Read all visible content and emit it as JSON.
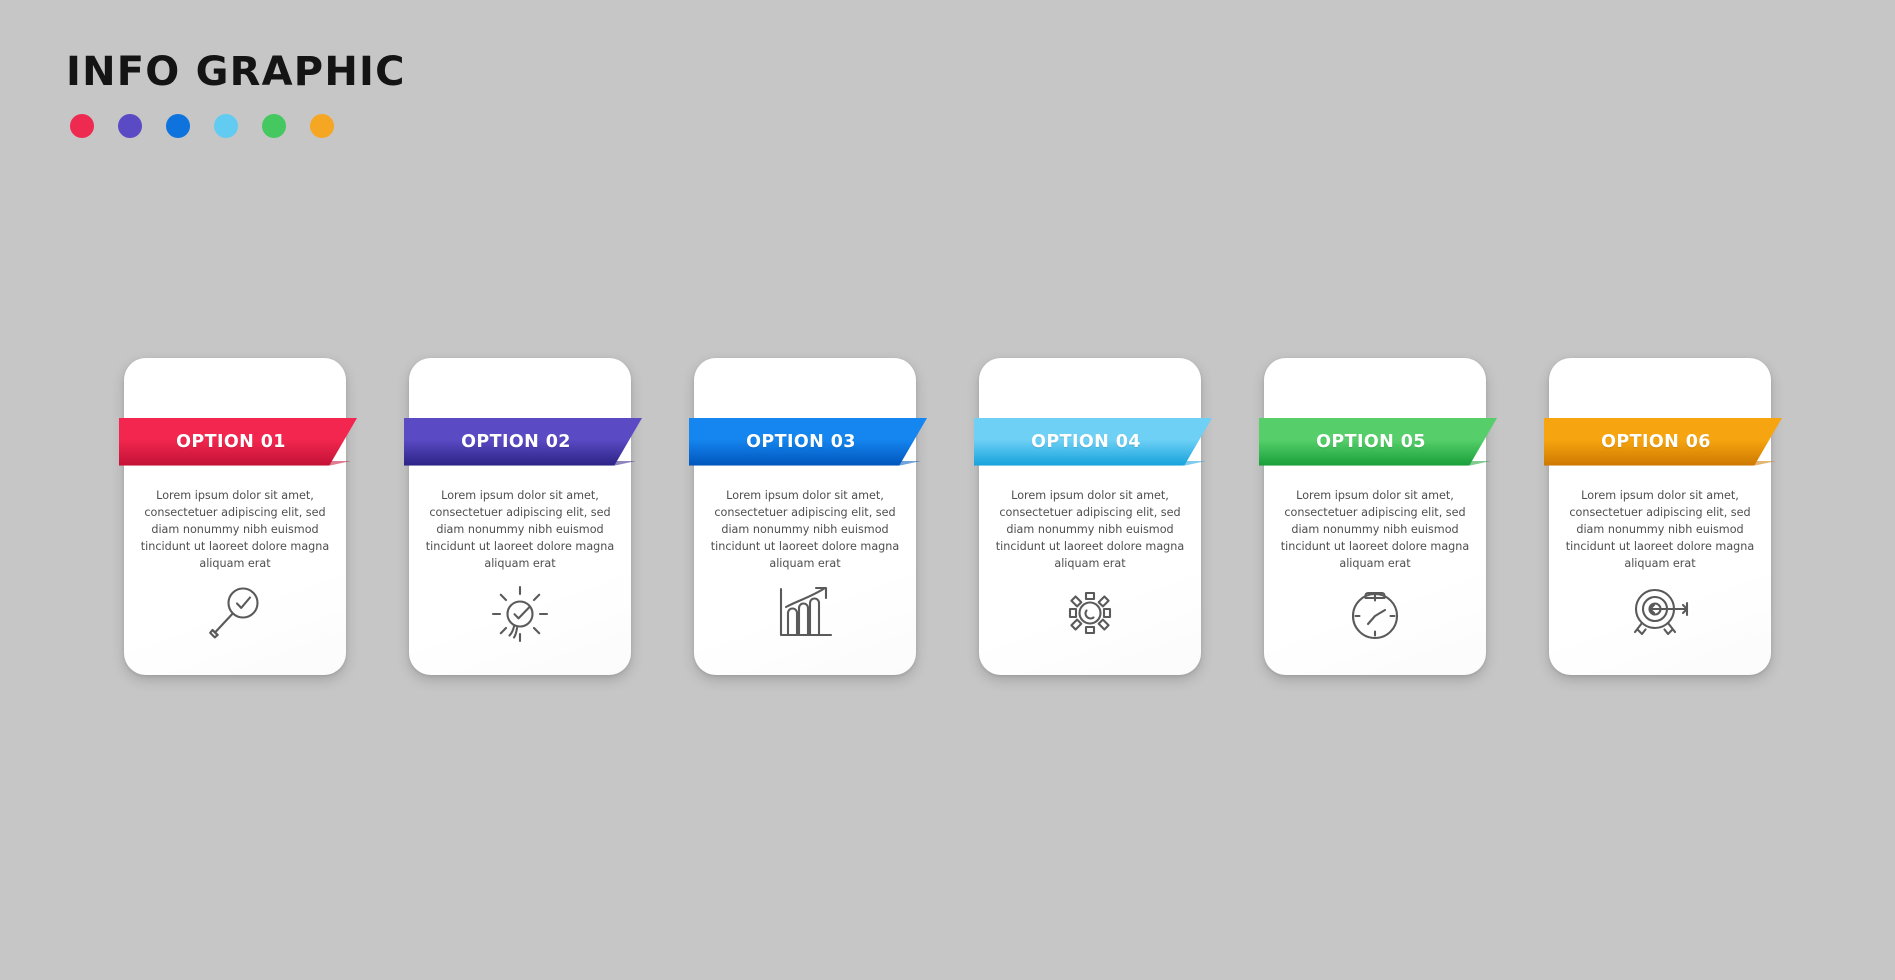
{
  "header": {
    "title": "INFO GRAPHIC",
    "palette_dots": [
      {
        "name": "dot-crimson",
        "color": "#ef2a51"
      },
      {
        "name": "dot-purple",
        "color": "#5a4ac4"
      },
      {
        "name": "dot-blue",
        "color": "#0e73dd"
      },
      {
        "name": "dot-sky",
        "color": "#62cbf2"
      },
      {
        "name": "dot-green",
        "color": "#45c койн"
      },
      {
        "name": "dot-orange",
        "color": "#f5a623"
      }
    ]
  },
  "body_text": "Lorem ipsum dolor sit amet, consectetuer adipiscing elit, sed diam nonummy nibh euismod tincidunt ut laoreet dolore magna aliquam erat",
  "cards": [
    {
      "label": "OPTION 01",
      "color_from": "#f2264f",
      "color_to": "#c41236",
      "icon": "magnifier-check-icon",
      "body": "Lorem ipsum dolor sit amet, consectetuer adipiscing elit, sed diam nonummy nibh euismod tincidunt ut laoreet dolore magna aliquam erat"
    },
    {
      "label": "OPTION 02",
      "color_from": "#5a4ac4",
      "color_to": "#2d2487",
      "icon": "lightbulb-check-icon",
      "body": "Lorem ipsum dolor sit amet, consectetuer adipiscing elit, sed diam nonummy nibh euismod tincidunt ut laoreet dolore magna aliquam erat"
    },
    {
      "label": "OPTION 03",
      "color_from": "#1585ef",
      "color_to": "#0057bd",
      "icon": "growth-chart-icon",
      "body": "Lorem ipsum dolor sit amet, consectetuer adipiscing elit, sed diam nonummy nibh euismod tincidunt ut laoreet dolore magna aliquam erat"
    },
    {
      "label": "OPTION 04",
      "color_from": "#6ed0f5",
      "color_to": "#18a3dd",
      "icon": "sun-rays-icon",
      "body": "Lorem ipsum dolor sit amet, consectetuer adipiscing elit, sed diam nonummy nibh euismod tincidunt ut laoreet dolore magna aliquam erat"
    },
    {
      "label": "OPTION 05",
      "color_from": "#56cf6a",
      "color_to": "#1aa03a",
      "icon": "stopwatch-icon",
      "body": "Lorem ipsum dolor sit amet, consectetuer adipiscing elit, sed diam nonummy nibh euismod tincidunt ut laoreet dolore magna aliquam erat"
    },
    {
      "label": "OPTION 06",
      "color_from": "#f6a510",
      "color_to": "#cf7a00",
      "icon": "target-arrow-icon",
      "body": "Lorem ipsum dolor sit amet, consectetuer adipiscing elit, sed diam nonummy nibh euismod tincidunt ut laoreet dolore magna aliquam erat"
    }
  ],
  "theme": {
    "background": "#c6c6c6",
    "card_background": "#ffffff",
    "title_color": "#141414",
    "body_text_color": "#4e4e4e",
    "icon_stroke": "#5a5a5a"
  }
}
